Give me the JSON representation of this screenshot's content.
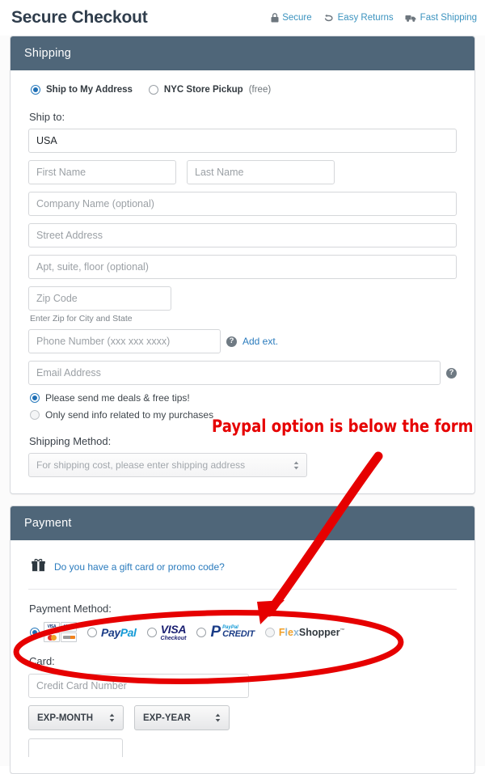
{
  "header": {
    "title": "Secure Checkout",
    "badges": [
      {
        "icon": "lock-icon",
        "label": "Secure"
      },
      {
        "icon": "return-arrow-icon",
        "label": "Easy Returns"
      },
      {
        "icon": "truck-icon",
        "label": "Fast Shipping"
      }
    ]
  },
  "shipping": {
    "section_title": "Shipping",
    "delivery_options": [
      {
        "label": "Ship to My Address",
        "note": "",
        "selected": true
      },
      {
        "label": "NYC Store Pickup",
        "note": "(free)",
        "selected": false
      }
    ],
    "ship_to_label": "Ship to:",
    "country_value": "USA",
    "first_name_placeholder": "First Name",
    "last_name_placeholder": "Last Name",
    "company_placeholder": "Company Name (optional)",
    "street_placeholder": "Street Address",
    "apt_placeholder": "Apt, suite, floor (optional)",
    "zip_placeholder": "Zip Code",
    "zip_helper": "Enter Zip for City and State",
    "phone_placeholder": "Phone Number (xxx xxx xxxx)",
    "add_ext_link": "Add ext.",
    "email_placeholder": "Email Address",
    "help_icon_char": "?",
    "marketing_options": [
      {
        "label": "Please send me deals & free tips!",
        "selected": true
      },
      {
        "label": "Only send info related to my purchases",
        "selected": false
      }
    ],
    "shipping_method_label": "Shipping Method:",
    "shipping_method_value": "For shipping cost, please enter shipping address"
  },
  "payment": {
    "section_title": "Payment",
    "gift_icon": "gift-icon",
    "promo_link": "Do you have a gift card or promo code?",
    "method_label": "Payment Method:",
    "methods": [
      {
        "id": "credit-cards",
        "label": "",
        "selected": true,
        "cards": [
          "VISA",
          "AMEX",
          "mastercard",
          "discover"
        ]
      },
      {
        "id": "paypal",
        "label": "PayPal",
        "selected": false
      },
      {
        "id": "visa-checkout",
        "label": "VISA Checkout",
        "selected": false
      },
      {
        "id": "paypal-credit",
        "label": "PayPal CREDIT",
        "selected": false
      },
      {
        "id": "flexshopper",
        "label": "FlexShopper",
        "selected": false
      }
    ],
    "card_label": "Card:",
    "card_number_placeholder": "Credit Card Number",
    "exp_month_label": "EXP-MONTH",
    "exp_year_label": "EXP-YEAR"
  },
  "annotations": {
    "note_text": "Paypal option is below the form",
    "note_color": "#e60000",
    "arrow": "red-arrow",
    "ellipse": "red-ellipse-around-payment-methods"
  }
}
